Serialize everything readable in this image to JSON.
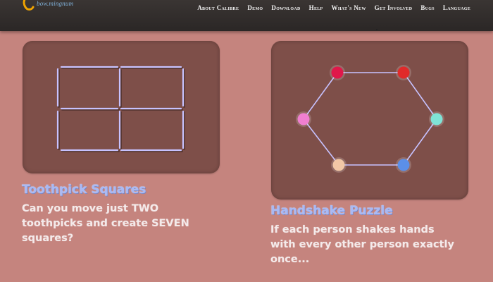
{
  "header": {
    "logo_tagline": "bow.mingnum",
    "nav": [
      "About Calibre",
      "Demo",
      "Download",
      "Help",
      "What's New",
      "Get Involved",
      "Bugs",
      "Language"
    ]
  },
  "puzzles": [
    {
      "title": "Toothpick Squares",
      "description": "Can you move just TWO toothpicks and create SEVEN squares?"
    },
    {
      "title": "Handshake Puzzle",
      "description": "If each person shakes hands with every other person exactly once..."
    }
  ],
  "handshake_people": [
    {
      "color": "#e0184a"
    },
    {
      "color": "#e02a2a"
    },
    {
      "color": "#7fe3d6"
    },
    {
      "color": "#5b8fe8"
    },
    {
      "color": "#f2c7a6"
    },
    {
      "color": "#f07fd0"
    }
  ],
  "colors": {
    "background": "#c5847e",
    "card": "#7e4f49",
    "title": "#a9b9f4",
    "toothpick": "#c7c2ff"
  }
}
